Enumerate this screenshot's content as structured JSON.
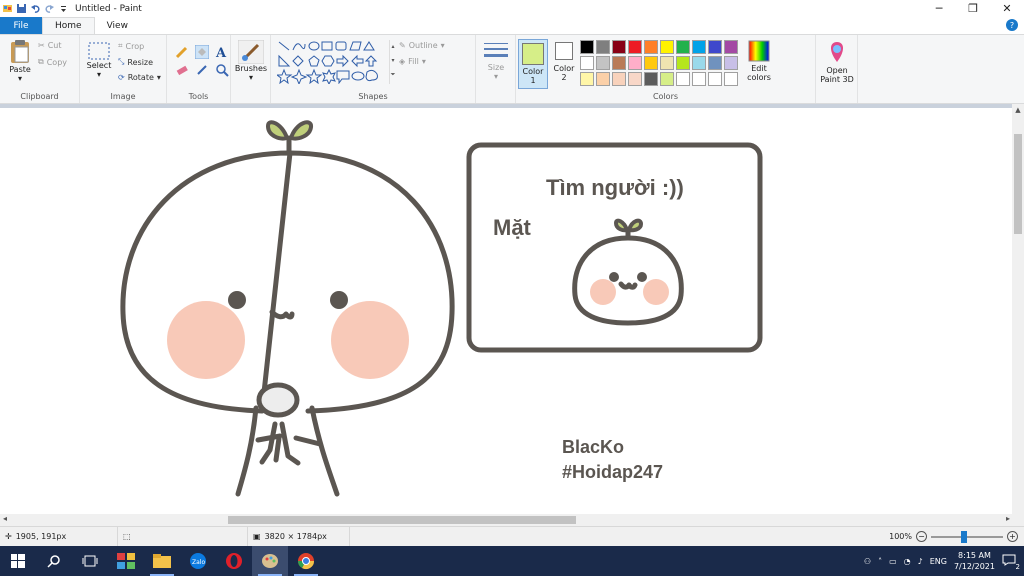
{
  "window": {
    "title": "Untitled - Paint"
  },
  "tabs": [
    {
      "label": "File"
    },
    {
      "label": "Home"
    },
    {
      "label": "View"
    }
  ],
  "ribbon": {
    "clipboard": {
      "label": "Clipboard",
      "paste": "Paste",
      "cut": "Cut",
      "copy": "Copy"
    },
    "image": {
      "label": "Image",
      "select": "Select",
      "crop": "Crop",
      "resize": "Resize",
      "rotate": "Rotate"
    },
    "tools": {
      "label": "Tools"
    },
    "brushes": {
      "label": "Brushes"
    },
    "shapes": {
      "label": "Shapes",
      "outline": "Outline",
      "fill": "Fill"
    },
    "size": {
      "label": "Size"
    },
    "colors": {
      "label": "Colors",
      "color1_label": "Color 1",
      "color2_label": "Color 2",
      "color1": "#d6ee88",
      "color2": "#ffffff",
      "edit_colors": "Edit colors",
      "palette": [
        "#000000",
        "#7f7f7f",
        "#880015",
        "#ed1c24",
        "#ff7f27",
        "#fff200",
        "#22b14c",
        "#00a2e8",
        "#3f48cc",
        "#a349a4",
        "#ffffff",
        "#c3c3c3",
        "#b97a57",
        "#ffaec9",
        "#ffc90e",
        "#efe4b0",
        "#b5e61d",
        "#99d9ea",
        "#7092be",
        "#c8bfe7",
        "#fff6a8",
        "#fbd0a8",
        "#f8d2bc",
        "#f8d7c8",
        "#5c5c5c",
        "#d6ee88",
        "#ffffff",
        "#ffffff",
        "#ffffff",
        "#ffffff"
      ]
    },
    "paint3d": {
      "label": "Open Paint 3D"
    }
  },
  "canvas": {
    "heading": "Tìm người :))",
    "label": "Mặt",
    "signature_name": "BlacKo",
    "signature_tag": "#Hoidap247"
  },
  "status": {
    "cursor": "1905, 191px",
    "size": "3820 × 1784px",
    "zoom": "100%"
  },
  "taskbar": {
    "language": "ENG",
    "time": "8:15 AM",
    "date": "7/12/2021",
    "notifications": "2"
  }
}
